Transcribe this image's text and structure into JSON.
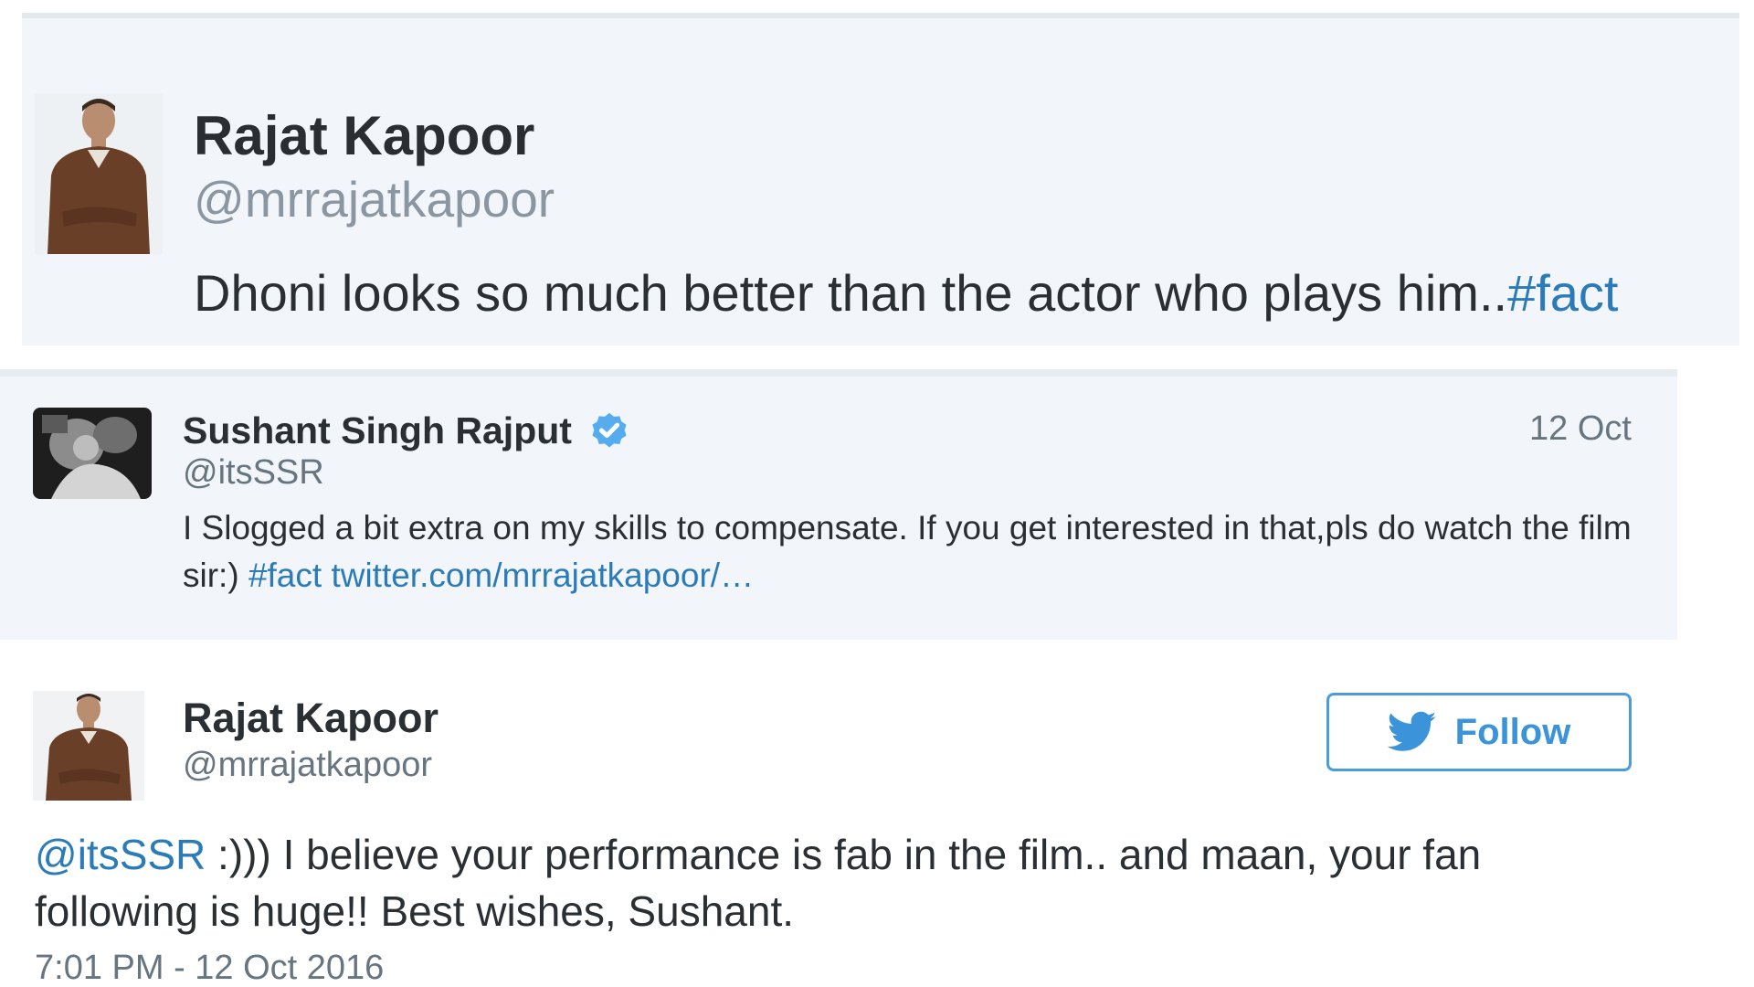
{
  "tweet_original": {
    "author_name": "Rajat Kapoor",
    "author_handle": "@mrrajatkapoor",
    "text": "Dhoni looks so much better than the actor who plays him..",
    "hashtag": "#fact"
  },
  "tweet_reply": {
    "author_name": "Sushant Singh Rajput",
    "author_handle": "@itsSSR",
    "date": "12 Oct",
    "text": "I Slogged a bit extra on my skills to compensate. If you get interested in that,pls do watch the film sir:)",
    "hashtag": "#fact",
    "link": "twitter.com/mrrajatkapoor/…"
  },
  "tweet_response": {
    "author_name": "Rajat Kapoor",
    "author_handle": "@mrrajatkapoor",
    "follow_label": "Follow",
    "mention": "@itsSSR",
    "text": " :))) I believe your performance is fab in the film.. and maan, your fan following is huge!! Best wishes, Sushant.",
    "timestamp": "7:01 PM - 12 Oct 2016"
  },
  "icons": {
    "verified": "verified-badge-icon",
    "bird": "twitter-bird-icon"
  },
  "colors": {
    "card_background": "#f2f6fa",
    "link": "#2b7bb9",
    "follow_border": "#4a9cde",
    "verified": "#55acee"
  }
}
